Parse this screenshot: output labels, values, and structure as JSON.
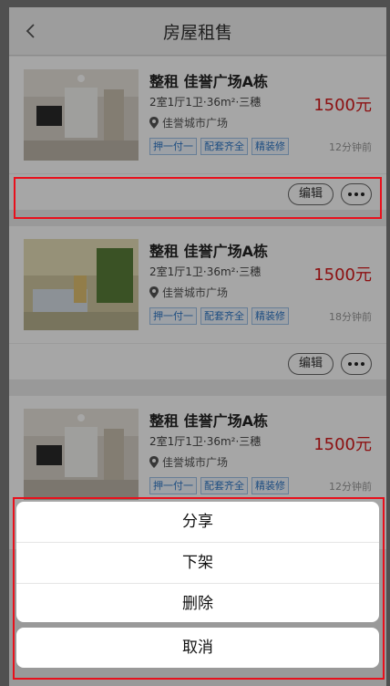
{
  "header": {
    "title": "房屋租售"
  },
  "listings": [
    {
      "title": "整租 佳誉广场A栋",
      "spec": "2室1厅1卫·36m²·三穗",
      "price": "1500元",
      "location": "佳誉城市广场",
      "tags": [
        "押一付一",
        "配套齐全",
        "精装修"
      ],
      "time": "12分钟前",
      "edit_label": "编辑"
    },
    {
      "title": "整租 佳誉广场A栋",
      "spec": "2室1厅1卫·36m²·三穗",
      "price": "1500元",
      "location": "佳誉城市广场",
      "tags": [
        "押一付一",
        "配套齐全",
        "精装修"
      ],
      "time": "18分钟前",
      "edit_label": "编辑"
    },
    {
      "title": "整租 佳誉广场A栋",
      "spec": "2室1厅1卫·36m²·三穗",
      "price": "1500元",
      "location": "佳誉城市广场",
      "tags": [
        "押一付一",
        "配套齐全",
        "精装修"
      ],
      "time": "12分钟前"
    }
  ],
  "action_sheet": {
    "items": [
      "分享",
      "下架",
      "删除"
    ],
    "cancel": "取消"
  },
  "colors": {
    "price": "#d7191b",
    "tag": "#2f78c8",
    "highlight": "#e8101c"
  }
}
